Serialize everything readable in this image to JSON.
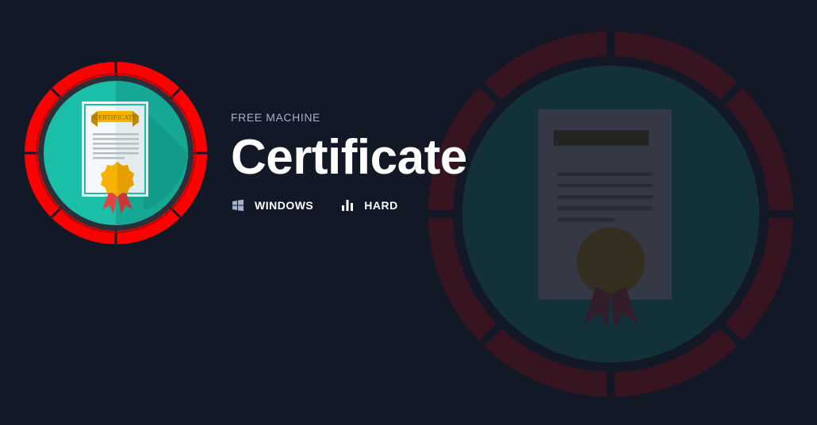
{
  "machine": {
    "eyebrow": "FREE MACHINE",
    "name": "Certificate",
    "os": {
      "label": "WINDOWS",
      "icon": "windows-icon"
    },
    "difficulty": {
      "label": "HARD",
      "icon": "difficulty-bars-icon"
    },
    "badge": {
      "icon": "certificate-icon",
      "certificate_text": "CERTIFICATE"
    }
  },
  "colors": {
    "background": "#121826",
    "ring": "#ff0000",
    "inner": "#1bbfa8",
    "seal": "#f5b300",
    "ribbon": "#e04545",
    "eyebrow": "#a4b1cd",
    "title": "#ffffff"
  }
}
